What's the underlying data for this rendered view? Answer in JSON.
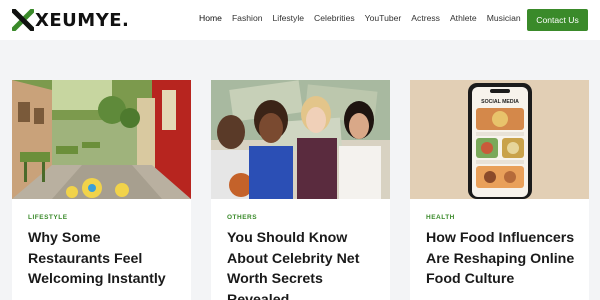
{
  "brand": {
    "name": "XEUMYE.",
    "accent": "#3a8a2a"
  },
  "nav": {
    "items": [
      {
        "label": "Home",
        "active": true
      },
      {
        "label": "Fashion"
      },
      {
        "label": "Lifestyle"
      },
      {
        "label": "Celebrities"
      },
      {
        "label": "YouTuber"
      },
      {
        "label": "Actress"
      },
      {
        "label": "Athlete"
      },
      {
        "label": "Musician"
      }
    ],
    "cta_label": "Contact Us"
  },
  "cards": [
    {
      "category": "LIFESTYLE",
      "title": "Why Some Restaurants Feel Welcoming Instantly",
      "image": "restaurant-street-photo"
    },
    {
      "category": "OTHERS",
      "title": "You Should Know About Celebrity Net Worth Secrets Revealed",
      "image": "celebrities-collage-photo"
    },
    {
      "category": "HEALTH",
      "title": "How Food Influencers Are Reshaping Online Food Culture",
      "image": "smartphone-social-media-photo",
      "phone_screen_title": "SOCIAL MEDIA"
    }
  ]
}
